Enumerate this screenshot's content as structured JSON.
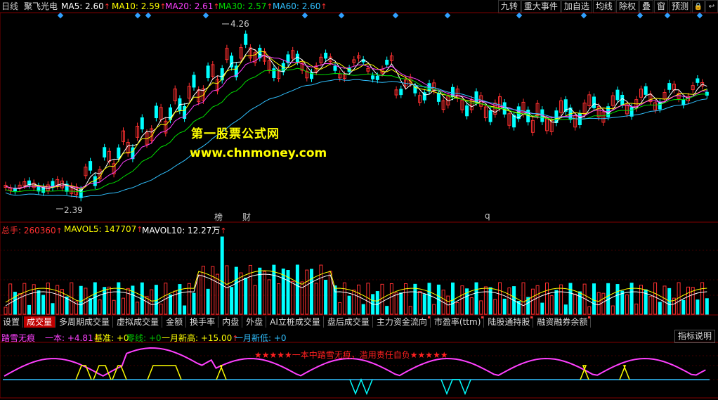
{
  "header": {
    "period": "日线",
    "stock": "聚飞光电",
    "ma5": {
      "label": "MA5: 2.60",
      "color": "#ffffff"
    },
    "ma10": {
      "label": "MA10: 2.59",
      "color": "#ffff00"
    },
    "ma20": {
      "label": "MA20: 2.61",
      "color": "#ff40ff"
    },
    "ma30": {
      "label": "MA30: 2.57",
      "color": "#00e000"
    },
    "ma60": {
      "label": "MA60: 2.60",
      "color": "#30c0ff"
    },
    "up_arrow": "↑",
    "buttons": [
      "九转",
      "重大事件",
      "加自选",
      "均线",
      "除权",
      "叠",
      "窗",
      "预测"
    ],
    "icon_buttons": [
      "lock-icon",
      "back-icon"
    ]
  },
  "main_chart": {
    "high_label": "4.26",
    "low_label": "2.39",
    "markers": [
      {
        "text": "榜",
        "color": "#ff3030"
      },
      {
        "text": "财",
        "color": "#ff3030"
      },
      {
        "text": "q",
        "color": "#ff3030"
      }
    ],
    "watermark_title": "第一股票公式网",
    "watermark_url": "www.chnmoney.com"
  },
  "volume": {
    "total_label": "总手: 260360",
    "mavol5_label": "MAVOL5: 147707",
    "mavol10_label": "MAVOL10: 12.27万",
    "total_color": "#ff3030",
    "mavol5_color": "#ffff00",
    "mavol10_color": "#ffffff"
  },
  "tabs": [
    {
      "label": "设置",
      "active": false,
      "dot": false
    },
    {
      "label": "成交量",
      "active": true,
      "dot": false
    },
    {
      "label": "多周期成交量",
      "active": false,
      "dot": false
    },
    {
      "label": "虚拟成交量",
      "active": false,
      "dot": false
    },
    {
      "label": "金额",
      "active": false,
      "dot": false
    },
    {
      "label": "换手率",
      "active": false,
      "dot": false
    },
    {
      "label": "内盘",
      "active": false,
      "dot": false
    },
    {
      "label": "外盘",
      "active": false,
      "dot": false
    },
    {
      "label": "AI立桩成交量",
      "active": false,
      "dot": false
    },
    {
      "label": "盘后成交量",
      "active": false,
      "dot": false
    },
    {
      "label": "主力资金流向",
      "active": false,
      "dot": true
    },
    {
      "label": "市盈率(ttm)",
      "active": false,
      "dot": true
    },
    {
      "label": "陆股通持股",
      "active": false,
      "dot": true
    },
    {
      "label": "融资融券余额",
      "active": false,
      "dot": true
    }
  ],
  "indicator": {
    "name": "踏雪无痕",
    "yiben": "一本: +4.81",
    "jizhun": "基准: +0",
    "lingxian": "零线: +0",
    "yue_gao": "一月新高: +15.00",
    "yue_di": "一月新低: +0",
    "disclaimer": "★★★★★一本中踏雪无痕，滥用责任自负★★★★★",
    "help_button": "指标说明"
  },
  "colors": {
    "up": "#ff3030",
    "down": "#00ffff",
    "name": "#ff40ff",
    "disclaimer": "#ff2020"
  }
}
